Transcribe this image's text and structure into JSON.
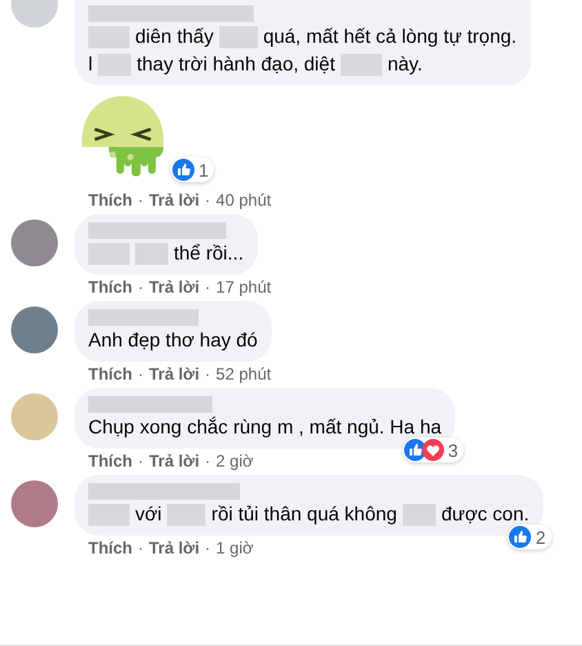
{
  "separator": "·",
  "comments": [
    {
      "lines": [
        [
          {
            "kind": "blur"
          },
          {
            "kind": "text",
            "text": "diên thấy"
          },
          {
            "kind": "blur"
          },
          {
            "kind": "text",
            "text": "quá, mất hết cả lòng tự trọng."
          }
        ],
        [
          {
            "kind": "text",
            "text": "l"
          },
          {
            "kind": "blur"
          },
          {
            "kind": "text",
            "text": "thay trời hành đạo, diệt"
          },
          {
            "kind": "blur"
          },
          {
            "kind": "text",
            "text": "này."
          }
        ]
      ],
      "attachment": {
        "kind": "sticker"
      },
      "reactions": {
        "icons": [
          {
            "kind": "like"
          }
        ],
        "count": "1"
      },
      "like": "Thích",
      "reply": "Trả lời",
      "time": "40 phút"
    },
    {
      "lines": [
        [
          {
            "kind": "blur"
          },
          {
            "kind": "blur"
          },
          {
            "kind": "text",
            "text": "thể rồi..."
          }
        ]
      ],
      "like": "Thích",
      "reply": "Trả lời",
      "time": "17 phút"
    },
    {
      "lines": [
        [
          {
            "kind": "text",
            "text": "Anh đẹp thơ hay đó"
          }
        ]
      ],
      "like": "Thích",
      "reply": "Trả lời",
      "time": "52 phút"
    },
    {
      "lines": [
        [
          {
            "kind": "text",
            "text": "Chụp xong chắc rùng m , mất ngủ. Ha ha"
          }
        ]
      ],
      "reactions": {
        "icons": [
          {
            "kind": "like"
          },
          {
            "kind": "love"
          }
        ],
        "count": "3"
      },
      "like": "Thích",
      "reply": "Trả lời",
      "time": "2 giờ"
    },
    {
      "lines": [
        [
          {
            "kind": "blur"
          },
          {
            "kind": "text",
            "text": "với"
          },
          {
            "kind": "blur"
          },
          {
            "kind": "text",
            "text": "rồi tủi thân quá không"
          },
          {
            "kind": "blur"
          },
          {
            "kind": "text",
            "text": "được con."
          }
        ]
      ],
      "reactions": {
        "icons": [
          {
            "kind": "like"
          }
        ],
        "count": "2"
      },
      "like": "Thích",
      "reply": "Trả lời",
      "time": "1 giờ"
    }
  ]
}
